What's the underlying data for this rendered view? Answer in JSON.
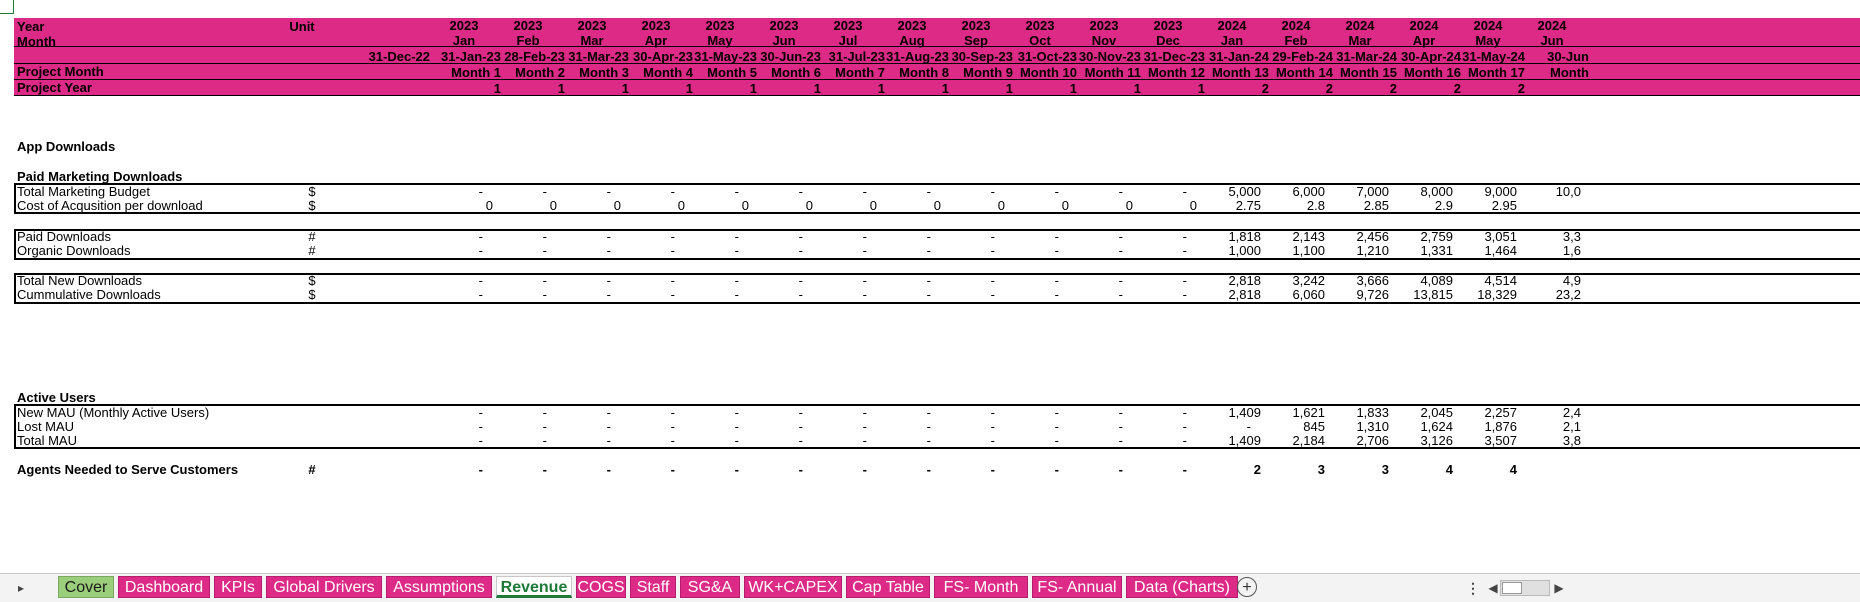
{
  "colors": {
    "header_pink": "#dd2a86",
    "tab_pink": "#dd2a86",
    "cover_green": "#9bce7a",
    "active_tab_text": "#1f7a3a"
  },
  "header": {
    "year_label": "Year",
    "unit_label": "Unit",
    "month_label": "Month",
    "project_month_label": "Project Month",
    "project_year_label": "Project Year",
    "first_date": "31-Dec-22",
    "columns": [
      {
        "year": "2023",
        "month": "Jan",
        "date": "31-Jan-23",
        "pm": "Month 1",
        "py": "1"
      },
      {
        "year": "2023",
        "month": "Feb",
        "date": "28-Feb-23",
        "pm": "Month 2",
        "py": "1"
      },
      {
        "year": "2023",
        "month": "Mar",
        "date": "31-Mar-23",
        "pm": "Month 3",
        "py": "1"
      },
      {
        "year": "2023",
        "month": "Apr",
        "date": "30-Apr-23",
        "pm": "Month 4",
        "py": "1"
      },
      {
        "year": "2023",
        "month": "May",
        "date": "31-May-23",
        "pm": "Month 5",
        "py": "1"
      },
      {
        "year": "2023",
        "month": "Jun",
        "date": "30-Jun-23",
        "pm": "Month 6",
        "py": "1"
      },
      {
        "year": "2023",
        "month": "Jul",
        "date": "31-Jul-23",
        "pm": "Month 7",
        "py": "1"
      },
      {
        "year": "2023",
        "month": "Aug",
        "date": "31-Aug-23",
        "pm": "Month 8",
        "py": "1"
      },
      {
        "year": "2023",
        "month": "Sep",
        "date": "30-Sep-23",
        "pm": "Month 9",
        "py": "1"
      },
      {
        "year": "2023",
        "month": "Oct",
        "date": "31-Oct-23",
        "pm": "Month 10",
        "py": "1"
      },
      {
        "year": "2023",
        "month": "Nov",
        "date": "30-Nov-23",
        "pm": "Month 11",
        "py": "1"
      },
      {
        "year": "2023",
        "month": "Dec",
        "date": "31-Dec-23",
        "pm": "Month 12",
        "py": "1"
      },
      {
        "year": "2024",
        "month": "Jan",
        "date": "31-Jan-24",
        "pm": "Month 13",
        "py": "2"
      },
      {
        "year": "2024",
        "month": "Feb",
        "date": "29-Feb-24",
        "pm": "Month 14",
        "py": "2"
      },
      {
        "year": "2024",
        "month": "Mar",
        "date": "31-Mar-24",
        "pm": "Month 15",
        "py": "2"
      },
      {
        "year": "2024",
        "month": "Apr",
        "date": "30-Apr-24",
        "pm": "Month 16",
        "py": "2"
      },
      {
        "year": "2024",
        "month": "May",
        "date": "31-May-24",
        "pm": "Month 17",
        "py": "2"
      },
      {
        "year": "2024",
        "month": "Jun",
        "date": "30-Jun",
        "pm": "Month",
        "py": ""
      }
    ]
  },
  "sections": {
    "app_downloads": "App Downloads",
    "paid_marketing": "Paid Marketing Downloads",
    "active_users": "Active Users"
  },
  "rows": {
    "budget": {
      "label": "Total Marketing Budget",
      "unit": "$",
      "values": [
        "-",
        "-",
        "-",
        "-",
        "-",
        "-",
        "-",
        "-",
        "-",
        "-",
        "-",
        "-",
        "5,000",
        "6,000",
        "7,000",
        "8,000",
        "9,000",
        "10,0"
      ]
    },
    "cac": {
      "label": "Cost of Acqusition per download",
      "unit": "$",
      "values": [
        "0",
        "0",
        "0",
        "0",
        "0",
        "0",
        "0",
        "0",
        "0",
        "0",
        "0",
        "0",
        "2.75",
        "2.8",
        "2.85",
        "2.9",
        "2.95",
        ""
      ]
    },
    "paid": {
      "label": "Paid Downloads",
      "unit": "#",
      "values": [
        "-",
        "-",
        "-",
        "-",
        "-",
        "-",
        "-",
        "-",
        "-",
        "-",
        "-",
        "-",
        "1,818",
        "2,143",
        "2,456",
        "2,759",
        "3,051",
        "3,3"
      ]
    },
    "organic": {
      "label": "Organic Downloads",
      "unit": "#",
      "values": [
        "-",
        "-",
        "-",
        "-",
        "-",
        "-",
        "-",
        "-",
        "-",
        "-",
        "-",
        "-",
        "1,000",
        "1,100",
        "1,210",
        "1,331",
        "1,464",
        "1,6"
      ]
    },
    "total_new": {
      "label": "Total New Downloads",
      "unit": "$",
      "values": [
        "-",
        "-",
        "-",
        "-",
        "-",
        "-",
        "-",
        "-",
        "-",
        "-",
        "-",
        "-",
        "2,818",
        "3,242",
        "3,666",
        "4,089",
        "4,514",
        "4,9"
      ]
    },
    "cumulative": {
      "label": "Cummulative Downloads",
      "unit": "$",
      "values": [
        "-",
        "-",
        "-",
        "-",
        "-",
        "-",
        "-",
        "-",
        "-",
        "-",
        "-",
        "-",
        "2,818",
        "6,060",
        "9,726",
        "13,815",
        "18,329",
        "23,2"
      ]
    },
    "new_mau": {
      "label": "New MAU (Monthly Active Users)",
      "unit": "",
      "values": [
        "-",
        "-",
        "-",
        "-",
        "-",
        "-",
        "-",
        "-",
        "-",
        "-",
        "-",
        "-",
        "1,409",
        "1,621",
        "1,833",
        "2,045",
        "2,257",
        "2,4"
      ]
    },
    "lost_mau": {
      "label": "Lost MAU",
      "unit": "",
      "values": [
        "-",
        "-",
        "-",
        "-",
        "-",
        "-",
        "-",
        "-",
        "-",
        "-",
        "-",
        "-",
        "-",
        "845",
        "1,310",
        "1,624",
        "1,876",
        "2,1"
      ]
    },
    "total_mau": {
      "label": "Total MAU",
      "unit": "",
      "values": [
        "-",
        "-",
        "-",
        "-",
        "-",
        "-",
        "-",
        "-",
        "-",
        "-",
        "-",
        "-",
        "1,409",
        "2,184",
        "2,706",
        "3,126",
        "3,507",
        "3,8"
      ]
    },
    "agents": {
      "label": "Agents Needed to Serve Customers",
      "unit": "#",
      "values": [
        "-",
        "-",
        "-",
        "-",
        "-",
        "-",
        "-",
        "-",
        "-",
        "-",
        "-",
        "-",
        "2",
        "3",
        "3",
        "4",
        "4",
        ""
      ]
    }
  },
  "tabs": [
    "Cover",
    "Dashboard",
    "KPIs",
    "Global Drivers",
    "Assumptions",
    "Revenue",
    "COGS",
    "Staff",
    "SG&A",
    "WK+CAPEX",
    "Cap Table",
    "FS- Month",
    "FS- Annual",
    "Data (Charts)"
  ],
  "active_tab": "Revenue",
  "icons": {
    "prev_sheet": "triangle-right-icon",
    "add_sheet": "plus-circle-icon",
    "more": "vertical-dots-icon"
  }
}
